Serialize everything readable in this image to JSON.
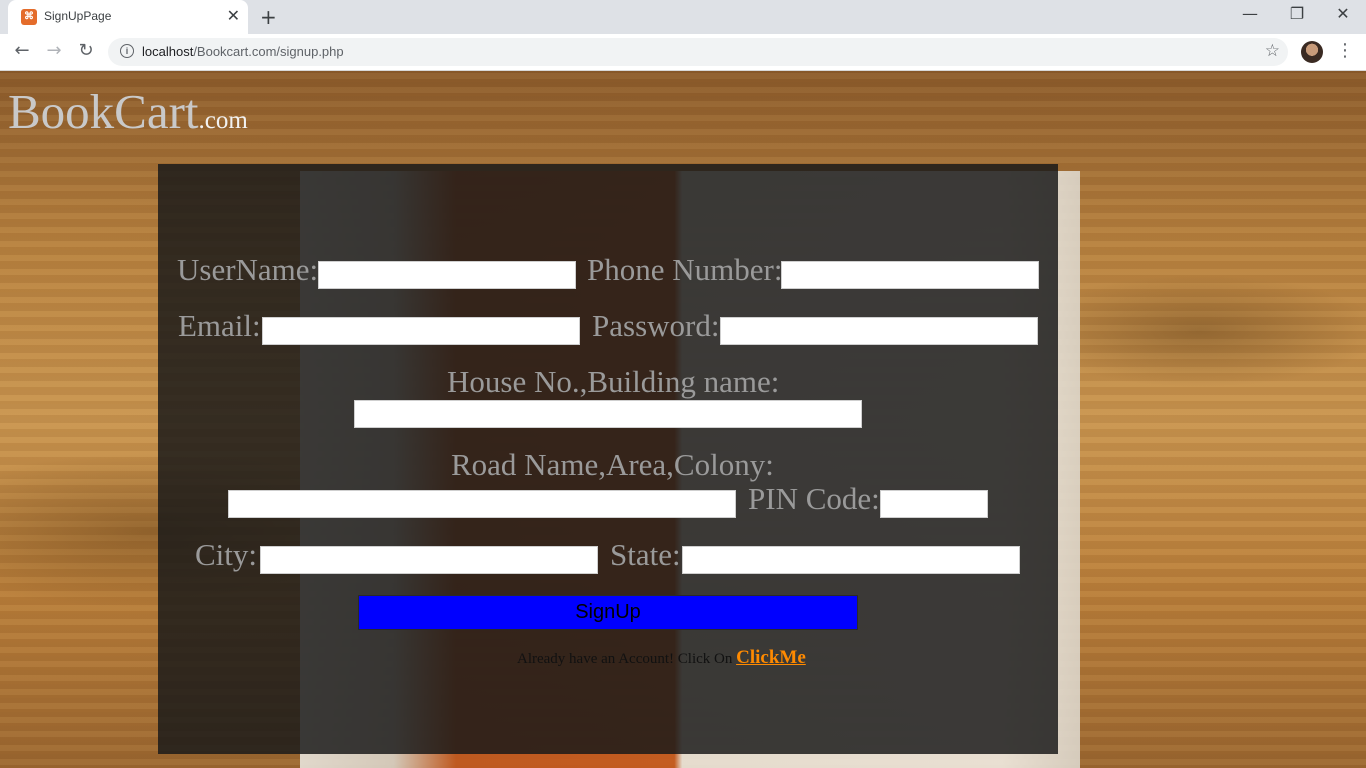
{
  "browser": {
    "tab_title": "SignUpPage",
    "tab_close": "✕",
    "new_tab": "+",
    "url_host": "localhost",
    "url_path": "/Bookcart.com/signup.php",
    "minimize": "—",
    "restore": "❐",
    "close": "✕"
  },
  "logo": {
    "main": "BookCart",
    "suffix": ".com"
  },
  "form": {
    "username_label": "UserName:",
    "phone_label": "Phone Number:",
    "email_label": "Email:",
    "password_label": "Password:",
    "house_label": "House No.,Building name:",
    "road_label": "Road Name,Area,Colony:",
    "pin_label": "PIN Code:",
    "city_label": "City:",
    "state_label": "State:",
    "submit_label": "SignUp",
    "already_text": "Already have an Account! Click On ",
    "login_link": "ClickMe"
  },
  "colors": {
    "submit_bg": "#0000ff",
    "link": "#ff8a00",
    "panel_bg": "rgba(25,25,25,0.84)"
  },
  "icons": [
    "xampp-favicon",
    "back-arrow-icon",
    "forward-arrow-icon",
    "reload-icon",
    "info-icon",
    "star-icon",
    "kebab-menu-icon"
  ]
}
